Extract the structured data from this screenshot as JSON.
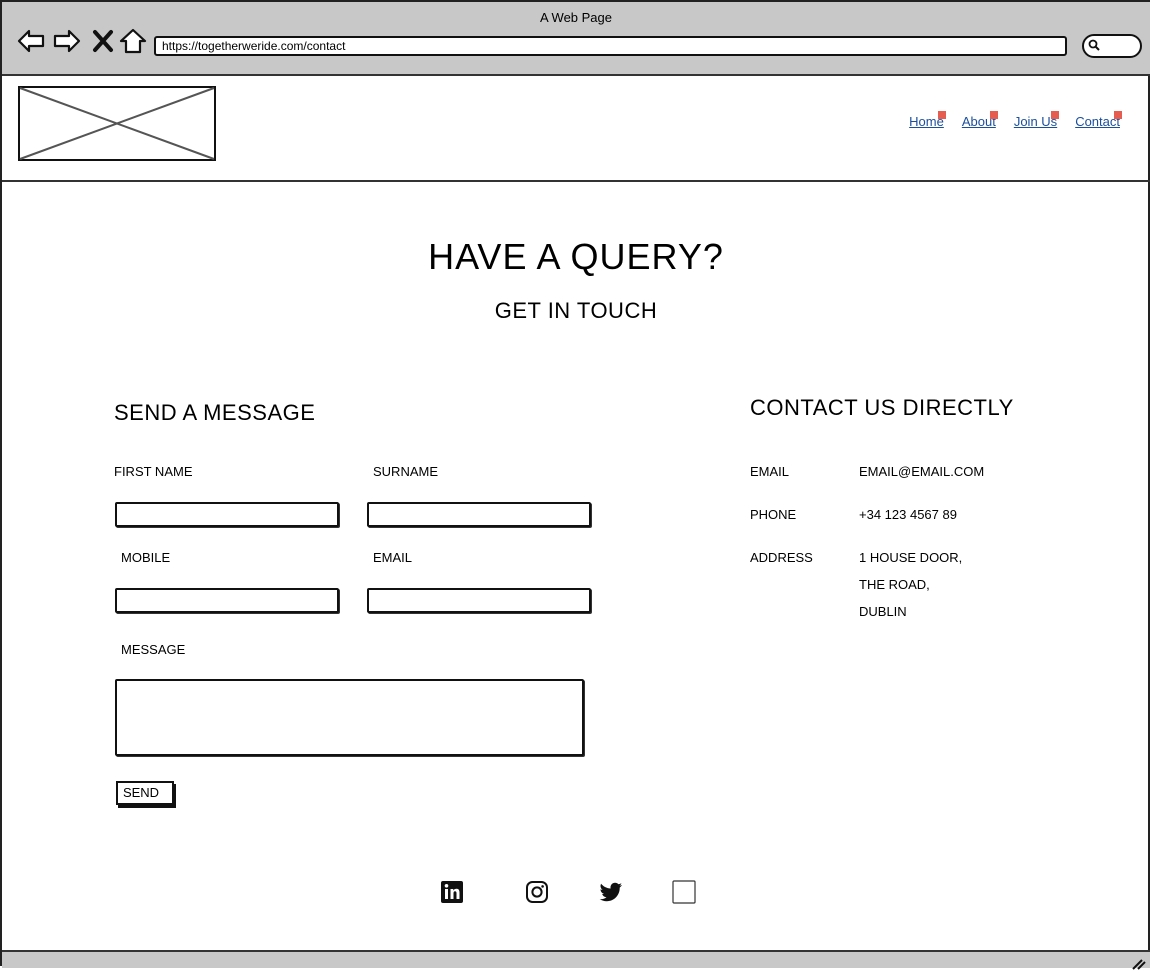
{
  "window": {
    "title": "A Web Page"
  },
  "browser": {
    "url": "https://togetherweride.com/contact"
  },
  "nav": {
    "items": [
      "Home",
      "About",
      "Join Us",
      "Contact"
    ]
  },
  "hero": {
    "title": "HAVE A QUERY?",
    "subtitle": "GET IN TOUCH"
  },
  "form": {
    "heading": "SEND A MESSAGE",
    "first_name_label": "FIRST NAME",
    "surname_label": "SURNAME",
    "mobile_label": "MOBILE",
    "email_label": "EMAIL",
    "message_label": "MESSAGE",
    "first_name_value": "",
    "surname_value": "",
    "mobile_value": "",
    "email_value": "",
    "message_value": "",
    "send_label": "SEND"
  },
  "contact": {
    "heading": "CONTACT US DIRECTLY",
    "email_label": "EMAIL",
    "email_value": "EMAIL@EMAIL.COM",
    "phone_label": "PHONE",
    "phone_value": "+34 123 4567 89",
    "address_label": "ADDRESS",
    "address_lines": [
      "1 HOUSE DOOR,",
      "THE ROAD,",
      "DUBLIN"
    ]
  },
  "social": {
    "icons": [
      "linkedin-icon",
      "instagram-icon",
      "twitter-icon",
      "blank-icon"
    ]
  },
  "colors": {
    "chrome": "#c8c8c8",
    "link": "#1b4f9c",
    "link_marker": "#e65c4f"
  }
}
